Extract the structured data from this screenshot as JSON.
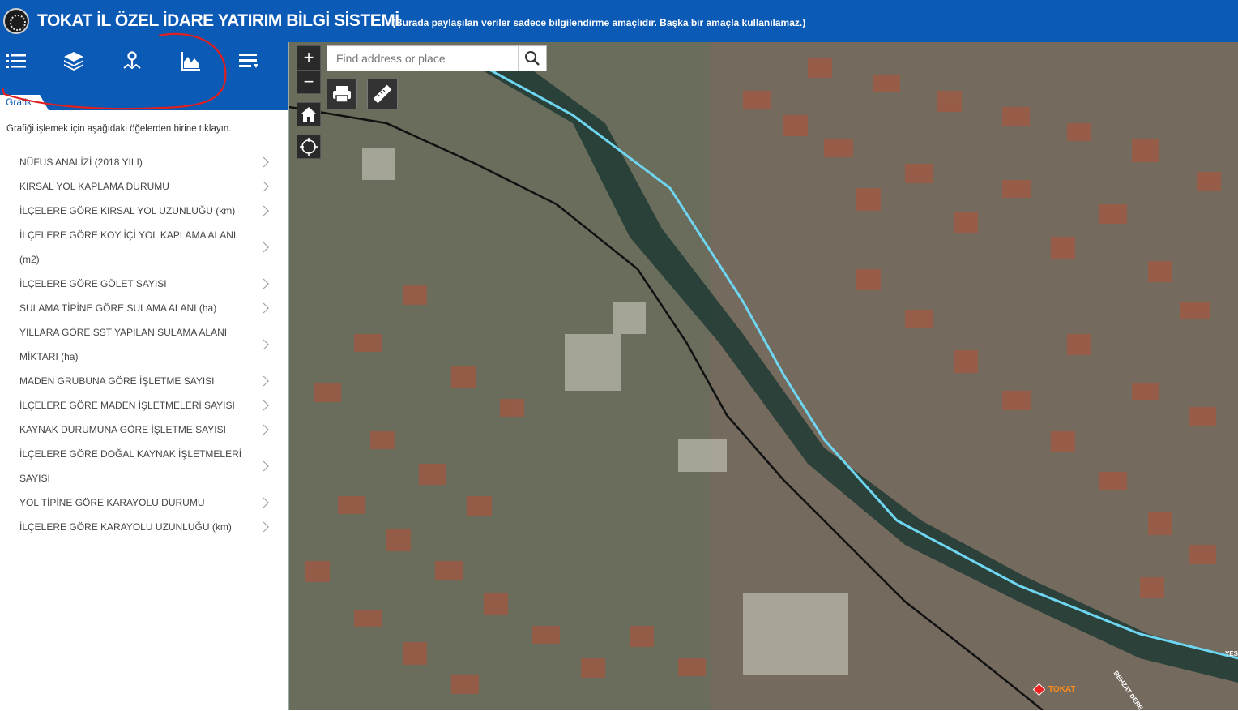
{
  "header": {
    "title": "TOKAT İL ÖZEL İDARE YATIRIM BİLGİ SİSTEMİ",
    "disclaimer": "(Burada paylaşılan veriler sadece bilgilendirme amaçlıdır. Başka bir amaçla kullanılamaz.)"
  },
  "toolbar": {
    "tools": [
      "list-icon",
      "layers-icon",
      "location-pin-icon",
      "chart-icon",
      "menu-icon"
    ]
  },
  "panel": {
    "tab_label": "Grafik",
    "instruction": "Grafiği işlemek için aşağıdaki öğelerden birine tıklayın.",
    "items": [
      "NÜFUS ANALİZİ (2018 YILI)",
      "KIRSAL YOL KAPLAMA DURUMU",
      "İLÇELERE GÖRE KIRSAL YOL UZUNLUĞU (km)",
      "İLÇELERE GÖRE KOY İÇİ YOL KAPLAMA ALANI (m2)",
      "İLÇELERE GÖRE GÖLET SAYISI",
      "SULAMA TİPİNE GÖRE SULAMA ALANI (ha)",
      "YILLARA GÖRE SST YAPILAN SULAMA ALANI MİKTARI (ha)",
      "MADEN GRUBUNA GÖRE İŞLETME SAYISI",
      "İLÇELERE GÖRE MADEN İŞLETMELERİ SAYISI",
      "KAYNAK DURUMUNA GÖRE İŞLETME SAYISI",
      "İLÇELERE GÖRE DOĞAL KAYNAK İŞLETMELERİ SAYISI",
      "YOL TİPİNE GÖRE KARAYOLU DURUMU",
      "İLÇELERE GÖRE KARAYOLU UZUNLUĞU (km)"
    ]
  },
  "map": {
    "zoom_in": "+",
    "zoom_out": "−",
    "search_placeholder": "Find address or place",
    "place_label": "TOKAT",
    "street_label_1": "YES",
    "street_label_2": "BEHZAT DERE"
  },
  "colors": {
    "header_blue": "#0b5ab5",
    "river_line": "#6fd6f2",
    "rail_line": "#111111",
    "annotation_red": "#e02020"
  }
}
